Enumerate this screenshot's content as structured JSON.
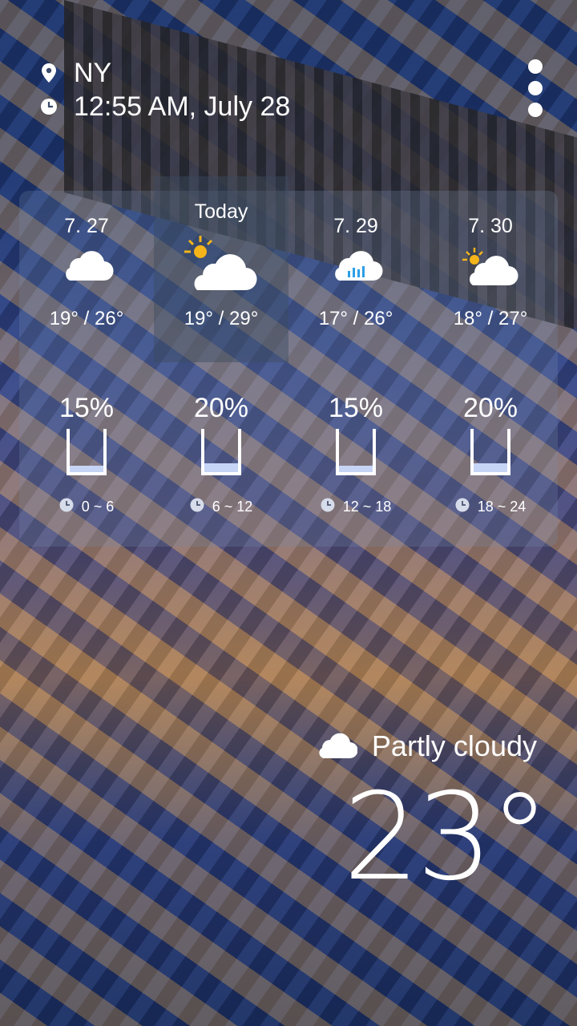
{
  "location": {
    "city": "NY",
    "icon": "location-pin-icon"
  },
  "datetime": {
    "text": "12:55  AM, July 28",
    "icon": "clock-icon"
  },
  "menu": {
    "icon": "more-vertical-icon"
  },
  "days": [
    {
      "date": "7. 27",
      "icon": "cloud-icon",
      "temps": "19° / 26°"
    },
    {
      "date": "Today",
      "icon": "partly-sunny-icon",
      "temps": "19° / 29°"
    },
    {
      "date": "7. 29",
      "icon": "rain-cloud-icon",
      "temps": "17° / 26°"
    },
    {
      "date": "7. 30",
      "icon": "partly-sunny-icon",
      "temps": "18° / 27°"
    }
  ],
  "hourly": [
    {
      "percent": "15%",
      "fill": 0.15,
      "range": "0 ~ 6"
    },
    {
      "percent": "20%",
      "fill": 0.2,
      "range": "6 ~ 12"
    },
    {
      "percent": "15%",
      "fill": 0.15,
      "range": "12 ~ 18"
    },
    {
      "percent": "20%",
      "fill": 0.2,
      "range": "18 ~ 24"
    }
  ],
  "current": {
    "condition": "Partly cloudy",
    "condition_icon": "partly-cloudy-night-icon",
    "temperature": "23°"
  }
}
